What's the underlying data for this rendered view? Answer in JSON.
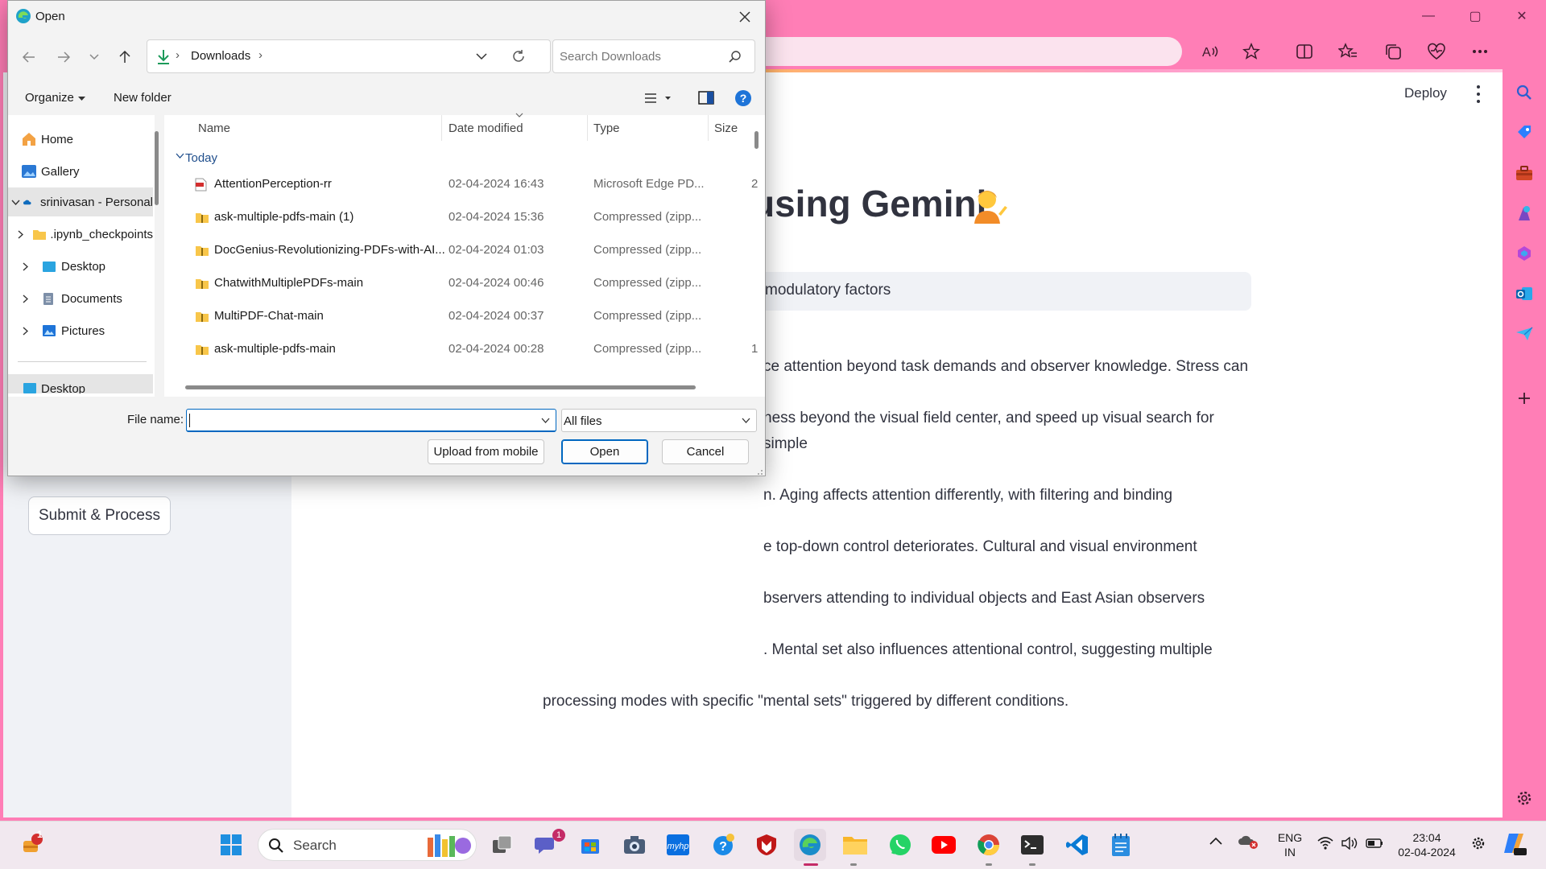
{
  "browser": {
    "window_controls": [
      "—",
      "▢",
      "✕"
    ],
    "toolbar_icons": [
      "read-aloud-icon",
      "favorite-star-icon",
      "split-screen-icon",
      "favorites-icon",
      "collections-icon",
      "performance-icon",
      "more-icon",
      "copilot-icon"
    ],
    "rail_icons": [
      "search-icon",
      "shopping-icon",
      "tools-icon",
      "games-icon",
      "microsoft-365-icon",
      "outlook-icon",
      "drop-icon",
      "add-icon",
      "settings-icon"
    ]
  },
  "page": {
    "deploy_label": "Deploy",
    "title_visible": "using Gemini",
    "question_visible": "modulatory factors",
    "answer_lines": [
      "ce attention beyond task demands and observer knowledge. Stress can",
      "ness beyond the visual field center, and speed up visual search for simple",
      "n. Aging affects attention differently, with filtering and binding",
      "e top-down control deteriorates. Cultural and visual environment",
      "bservers attending to individual objects and East Asian observers",
      ". Mental set also influences attentional control, suggesting multiple",
      "processing modes with specific \"mental sets\" triggered by different conditions."
    ],
    "submit_label": "Submit & Process"
  },
  "dialog": {
    "title": "Open",
    "breadcrumb": {
      "separator": "›",
      "location": "Downloads"
    },
    "search_placeholder": "Search Downloads",
    "organize_label": "Organize",
    "new_folder_label": "New folder",
    "nav_items": [
      {
        "label": "Home",
        "icon": "home-icon"
      },
      {
        "label": "Gallery",
        "icon": "gallery-icon"
      },
      {
        "label": "srinivasan - Personal",
        "icon": "onedrive-icon"
      },
      {
        "label": ".ipynb_checkpoints",
        "icon": "folder-icon"
      },
      {
        "label": "Desktop",
        "icon": "desktop-folder-icon"
      },
      {
        "label": "Documents",
        "icon": "documents-folder-icon"
      },
      {
        "label": "Pictures",
        "icon": "pictures-folder-icon"
      },
      {
        "label": "Desktop",
        "icon": "desktop-folder-icon"
      }
    ],
    "columns": {
      "name": "Name",
      "date": "Date modified",
      "type": "Type",
      "size": "Size"
    },
    "group_label": "Today",
    "files": [
      {
        "name": "AttentionPerception-rr",
        "date": "02-04-2024 16:43",
        "type": "Microsoft Edge PD...",
        "size": "2",
        "icon": "pdf-icon"
      },
      {
        "name": "ask-multiple-pdfs-main (1)",
        "date": "02-04-2024 15:36",
        "type": "Compressed (zipp...",
        "size": "",
        "icon": "zip-folder-icon"
      },
      {
        "name": "DocGenius-Revolutionizing-PDFs-with-AI...",
        "date": "02-04-2024 01:03",
        "type": "Compressed (zipp...",
        "size": "",
        "icon": "zip-folder-icon"
      },
      {
        "name": "ChatwithMultiplePDFs-main",
        "date": "02-04-2024 00:46",
        "type": "Compressed (zipp...",
        "size": "",
        "icon": "zip-folder-icon"
      },
      {
        "name": "MultiPDF-Chat-main",
        "date": "02-04-2024 00:37",
        "type": "Compressed (zipp...",
        "size": "",
        "icon": "zip-folder-icon"
      },
      {
        "name": "ask-multiple-pdfs-main",
        "date": "02-04-2024 00:28",
        "type": "Compressed (zipp...",
        "size": "1",
        "icon": "zip-folder-icon"
      }
    ],
    "file_name_label": "File name:",
    "file_name_value": "",
    "filter_value": "All files",
    "buttons": {
      "upload": "Upload from mobile",
      "open": "Open",
      "cancel": "Cancel"
    }
  },
  "taskbar": {
    "search_placeholder": "Search",
    "notification_badge": "1",
    "teams_badge": "1",
    "lang_line1": "ENG",
    "lang_line2": "IN",
    "time": "23:04",
    "date": "02-04-2024"
  }
}
